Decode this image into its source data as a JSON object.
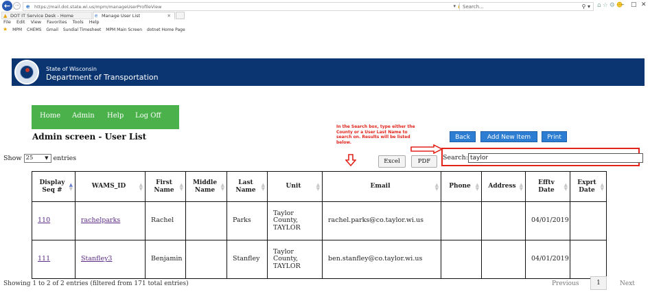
{
  "browser": {
    "url": "https://mail.dot.state.wi.us/mpm/manageUserProfileView",
    "search_placeholder": "Search...",
    "tabs": [
      {
        "label": "DOT IT Service Desk - Home"
      },
      {
        "label": "Manage User List"
      }
    ],
    "menu": [
      "File",
      "Edit",
      "View",
      "Favorites",
      "Tools",
      "Help"
    ],
    "favorites": [
      "MPM",
      "CHEMS",
      "Gmail",
      "Sundial Timesheet",
      "MPM Main Screen",
      "dotnet Home Page"
    ]
  },
  "header": {
    "line1": "State of Wisconsin",
    "line2": "Department of Transportation"
  },
  "nav": {
    "home": "Home",
    "admin": "Admin",
    "help": "Help",
    "logoff": "Log Off"
  },
  "page_title": "Admin screen - User List",
  "annotation": "In the Search box, type either the County or a User Last Name to search on.  Results will be listed below.",
  "actions": {
    "back": "Back",
    "add_new": "Add New Item",
    "print": "Print",
    "excel": "Excel",
    "pdf": "PDF"
  },
  "table_controls": {
    "show_prefix": "Show",
    "page_size": "25",
    "show_suffix": "entries",
    "search_label": "Search:",
    "search_value": "taylor"
  },
  "columns": [
    {
      "l1": "Display",
      "l2": "Seq #"
    },
    {
      "l1": "WAMS_ID",
      "l2": ""
    },
    {
      "l1": "First",
      "l2": "Name"
    },
    {
      "l1": "Middle",
      "l2": "Name"
    },
    {
      "l1": "Last",
      "l2": "Name"
    },
    {
      "l1": "Unit",
      "l2": ""
    },
    {
      "l1": "Email",
      "l2": ""
    },
    {
      "l1": "Phone",
      "l2": ""
    },
    {
      "l1": "Address",
      "l2": ""
    },
    {
      "l1": "Efftv",
      "l2": "Date"
    },
    {
      "l1": "Exprt",
      "l2": "Date"
    }
  ],
  "rows": [
    {
      "seq": "110",
      "wams_id": "rachelparks",
      "first": "Rachel",
      "middle": "",
      "last": "Parks",
      "unit": [
        "Taylor",
        "County,",
        "TAYLOR"
      ],
      "email": "rachel.parks@co.taylor.wi.us",
      "phone": "",
      "address": "",
      "efftv": "04/01/2019",
      "exprt": ""
    },
    {
      "seq": "111",
      "wams_id": "Stanfley3",
      "first": "Benjamin",
      "middle": "",
      "last": "Stanfley",
      "unit": [
        "Taylor",
        "County,",
        "TAYLOR"
      ],
      "email": "ben.stanfley@co.taylor.wi.us",
      "phone": "",
      "address": "",
      "efftv": "04/01/2019",
      "exprt": ""
    }
  ],
  "footer": {
    "info": "Showing 1 to 2 of 2 entries (filtered from 171 total entries)",
    "previous": "Previous",
    "page": "1",
    "next": "Next"
  }
}
